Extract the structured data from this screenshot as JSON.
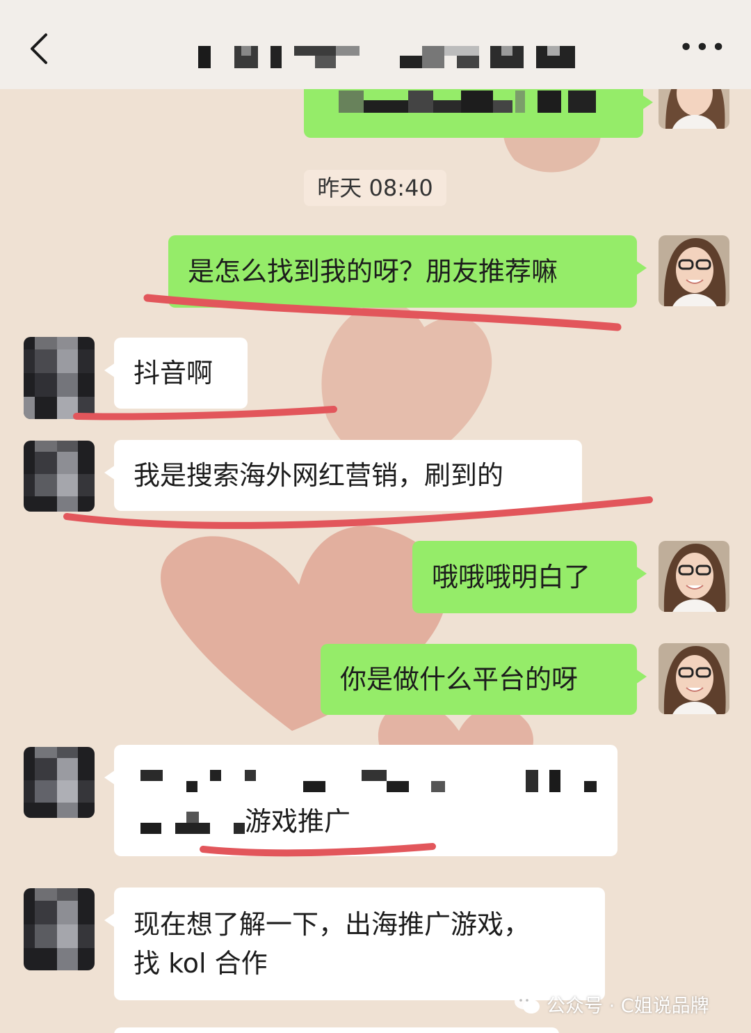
{
  "header": {
    "back_icon": "chevron-left-icon",
    "more_icon": "more-horizontal-icon",
    "more_label": "•••",
    "title_redacted": true
  },
  "timestamp": "昨天 08:40",
  "messages": [
    {
      "side": "me",
      "text": "是怎么找到我的呀？朋友推荐嘛"
    },
    {
      "side": "them",
      "text": "抖音啊"
    },
    {
      "side": "them",
      "text": "我是搜索海外网红营销，刷到的"
    },
    {
      "side": "me",
      "text": "哦哦哦明白了"
    },
    {
      "side": "me",
      "text": "你是做什么平台的呀"
    },
    {
      "side": "them",
      "text_visible_part": "游戏推广",
      "partially_redacted": true
    },
    {
      "side": "them",
      "line1": "现在想了解一下，出海推广游戏，",
      "line2": "找 kol 合作"
    }
  ],
  "watermark": {
    "text": "公众号 · C姐说品牌",
    "icon": "wechat-icon"
  },
  "colors": {
    "my_bubble": "#95ec69",
    "their_bubble": "#ffffff",
    "underline": "#e2565b",
    "wallpaper": "#efe0d2"
  }
}
